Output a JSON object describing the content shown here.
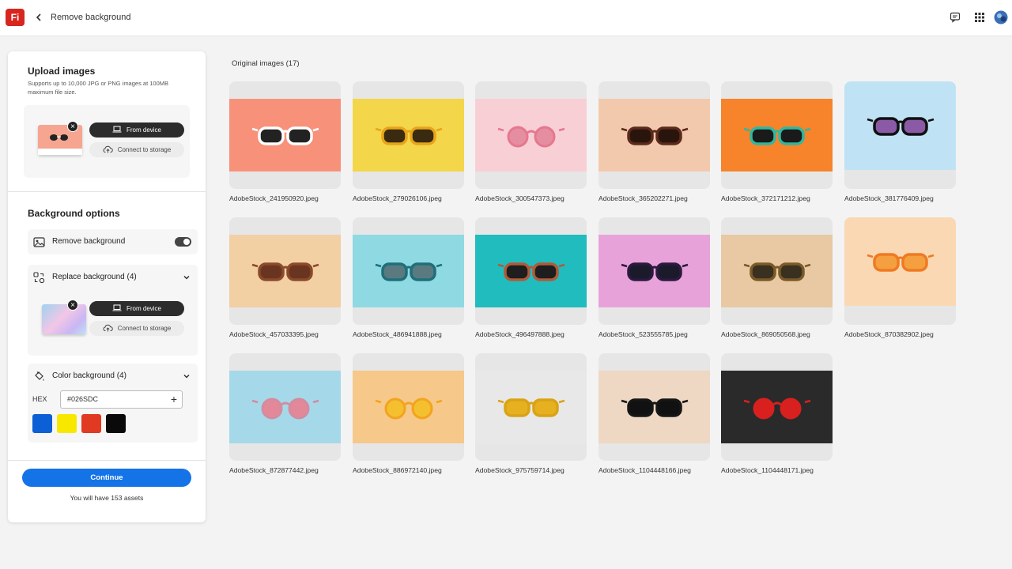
{
  "topbar": {
    "app_logo": "Fi",
    "title": "Remove background",
    "icons": [
      "back-icon",
      "chat-icon",
      "apps-grid-icon",
      "avatar"
    ]
  },
  "upload": {
    "title": "Upload images",
    "hint": "Supports up to 10,000 JPG or PNG images at 100MB maximum file size.",
    "from_device": "From device",
    "connect_storage": "Connect to storage"
  },
  "bg_options": {
    "title": "Background options",
    "remove_label": "Remove background",
    "remove_enabled": true,
    "replace_label": "Replace background (4)",
    "replace_from_device": "From device",
    "replace_connect_storage": "Connect to storage",
    "color_label": "Color background (4)",
    "hex_label": "HEX",
    "hex_value": "#026SDC",
    "swatches": [
      "#0d5fd6",
      "#f8e800",
      "#e03a22",
      "#0a0a0a"
    ]
  },
  "footer": {
    "continue": "Continue",
    "assets_note": "You will have 153 assets"
  },
  "gallery": {
    "title": "Original images (17)",
    "files": [
      "AdobeStock_241950920.jpeg",
      "AdobeStock_279026106.jpeg",
      "AdobeStock_300547373.jpeg",
      "AdobeStock_365202271.jpeg",
      "AdobeStock_372171212.jpeg",
      "AdobeStock_381776409.jpeg",
      "AdobeStock_457033395.jpeg",
      "AdobeStock_486941888.jpeg",
      "AdobeStock_496497888.jpeg",
      "AdobeStock_523555785.jpeg",
      "AdobeStock_869050568.jpeg",
      "AdobeStock_870382902.jpeg",
      "AdobeStock_872877442.jpeg",
      "AdobeStock_886972140.jpeg",
      "AdobeStock_975759714.jpeg",
      "AdobeStock_1104448166.jpeg",
      "AdobeStock_1104448171.jpeg"
    ],
    "backgrounds": [
      "#f8917a",
      "#f3d64a",
      "#f9cfd6",
      "#f3c9ad",
      "#f7832a",
      "#bfe3f5",
      "#f3cfa4",
      "#8fd9e3",
      "#21bcbd",
      "#e8a2da",
      "#e8c9a3",
      "#fbd8b4",
      "#a5d9ea",
      "#f6c88a",
      "#e8e8e8",
      "#eed8c4",
      "#2a2a2a"
    ],
    "frame_colors": [
      "#ffffff",
      "#e8a41a",
      "#e5788e",
      "#5b2a1c",
      "#2fb7a0",
      "#111111",
      "#8a4a2c",
      "#1f6f7a",
      "#b05a3a",
      "#2b1a40",
      "#7a5a28",
      "#ef7a22",
      "#d28ca0",
      "#f2a41e",
      "#d9a316",
      "#161616",
      "#d8201e"
    ],
    "lens_colors": [
      "#222222",
      "#3a2a10",
      "#e58ea1",
      "#2a150d",
      "#1a1a1a",
      "#8a5aa6",
      "#6a3520",
      "#5a7a80",
      "#1e1e1e",
      "#1a1a2a",
      "#3a3020",
      "#f5a040",
      "#e38898",
      "#f5c030",
      "#e6b020",
      "#111111",
      "#d8201e"
    ]
  }
}
